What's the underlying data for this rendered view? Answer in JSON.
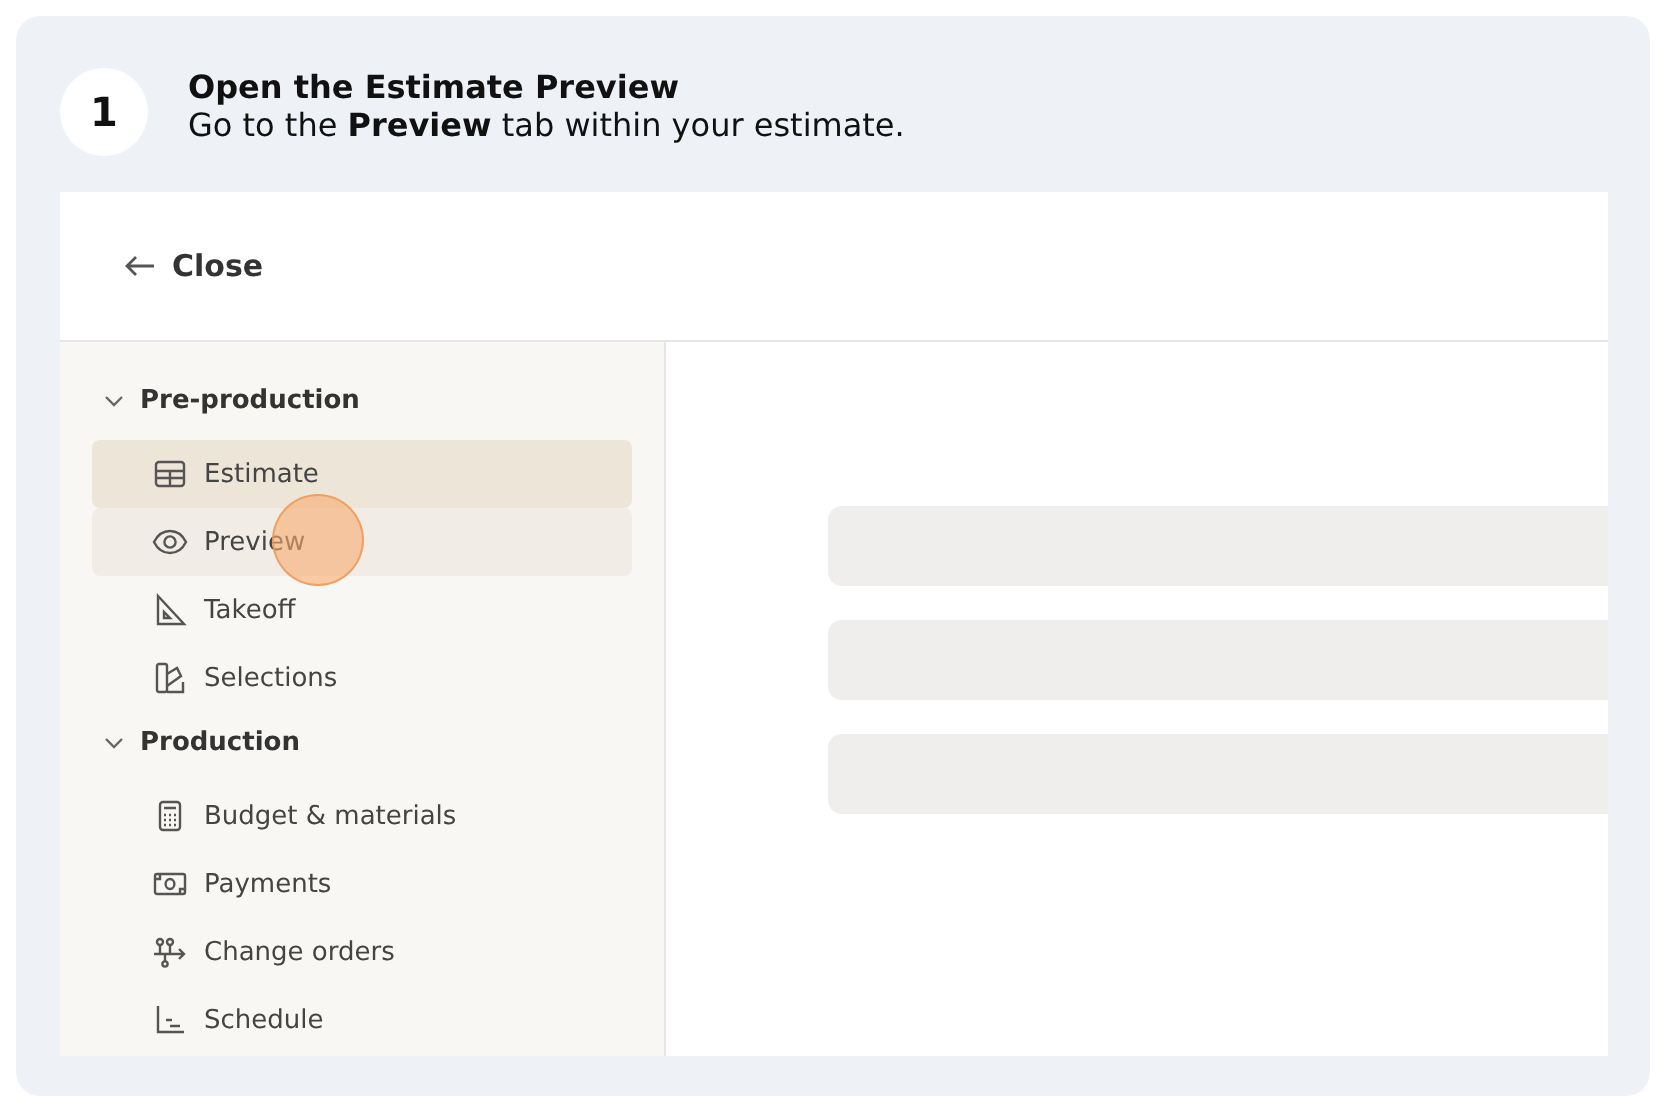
{
  "step": {
    "number": "1",
    "title": "Open the Estimate Preview",
    "description": "Go to the **Preview** tab within your estimate."
  },
  "header": {
    "close_label": "Close"
  },
  "sidebar": {
    "sections": [
      {
        "label": "Pre-production",
        "expanded": true,
        "items": [
          {
            "label": "Estimate",
            "selected": true,
            "hovered": false,
            "clicked": false
          },
          {
            "label": "Preview",
            "selected": false,
            "hovered": true,
            "clicked": true
          },
          {
            "label": "Takeoff",
            "selected": false,
            "hovered": false,
            "clicked": false
          },
          {
            "label": "Selections",
            "selected": false,
            "hovered": false,
            "clicked": false
          }
        ]
      },
      {
        "label": "Production",
        "expanded": true,
        "items": [
          {
            "label": "Budget & materials",
            "selected": false,
            "hovered": false,
            "clicked": false
          },
          {
            "label": "Payments",
            "selected": false,
            "hovered": false,
            "clicked": false
          },
          {
            "label": "Change orders",
            "selected": false,
            "hovered": false,
            "clicked": false
          },
          {
            "label": "Schedule",
            "selected": false,
            "hovered": false,
            "clicked": false
          }
        ]
      }
    ]
  }
}
